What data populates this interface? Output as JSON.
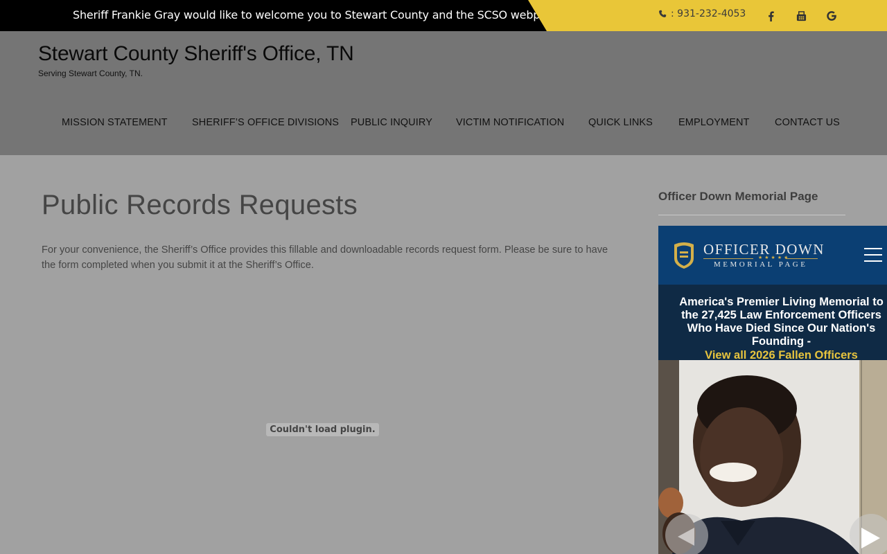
{
  "topbar": {
    "welcome": "Sheriff Frankie Gray would like to welcome you to Stewart County and the SCSO webpage",
    "phone": ": 931-232-4053",
    "social": [
      "facebook-icon",
      "fax-icon",
      "google-icon"
    ],
    "colors": {
      "bar": "#000000",
      "accent": "#e9c638"
    }
  },
  "header": {
    "title": "Stewart County Sheriff's Office, TN",
    "tagline": "Serving Stewart County, TN."
  },
  "nav": {
    "items": [
      "MISSION STATEMENT",
      "SHERIFF’S OFFICE DIVISIONS",
      "PUBLIC INQUIRY",
      "VICTIM NOTIFICATION",
      "QUICK LINKS",
      "EMPLOYMENT",
      "CONTACT US"
    ]
  },
  "main": {
    "title": "Public Records Requests",
    "intro": "For your convenience, the Sheriff’s Office provides this fillable and downloadable records request form. Please be sure to have the form completed when you submit it at the Sheriff’s Office.",
    "plugin_error": "Couldn't load plugin."
  },
  "sidebar": {
    "widget_title": "Officer Down Memorial Page",
    "odmp": {
      "name": "OFFICER DOWN",
      "sub": "MEMORIAL PAGE",
      "stars": "★★★★★",
      "headline": "America's Premier Living Memorial to the 27,425 Law Enforcement Officers Who Have Died Since Our Nation's Founding -",
      "link": "View all 2026 Fallen Officers",
      "colors": {
        "header": "#0b3f73",
        "banner": "#0f2a45",
        "link": "#e7c43e"
      }
    }
  }
}
